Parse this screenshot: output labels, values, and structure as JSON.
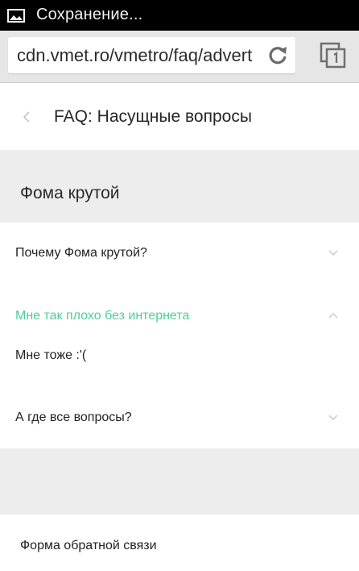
{
  "status_bar": {
    "text": "Сохранение...",
    "icon": "image-icon"
  },
  "browser": {
    "url": "cdn.vmet.ro/vmetro/faq/advert",
    "reload_icon": "reload-icon",
    "tabs_icon": "tabs-icon"
  },
  "header": {
    "back_icon": "chevron-left-icon",
    "title": "FAQ: Насущные вопросы"
  },
  "section": {
    "title": "Фома крутой"
  },
  "faq": [
    {
      "question": "Почему Фома крутой?",
      "expanded": false
    },
    {
      "question": "Мне так плохо без интернета",
      "expanded": true,
      "answer": "Мне тоже :'("
    },
    {
      "question": "А где все вопросы?",
      "expanded": false
    }
  ],
  "footer": {
    "feedback_link": "Форма обратной связи"
  },
  "colors": {
    "accent": "#4ccf9a",
    "section_bg": "#ededed",
    "status_bg": "#000000"
  }
}
